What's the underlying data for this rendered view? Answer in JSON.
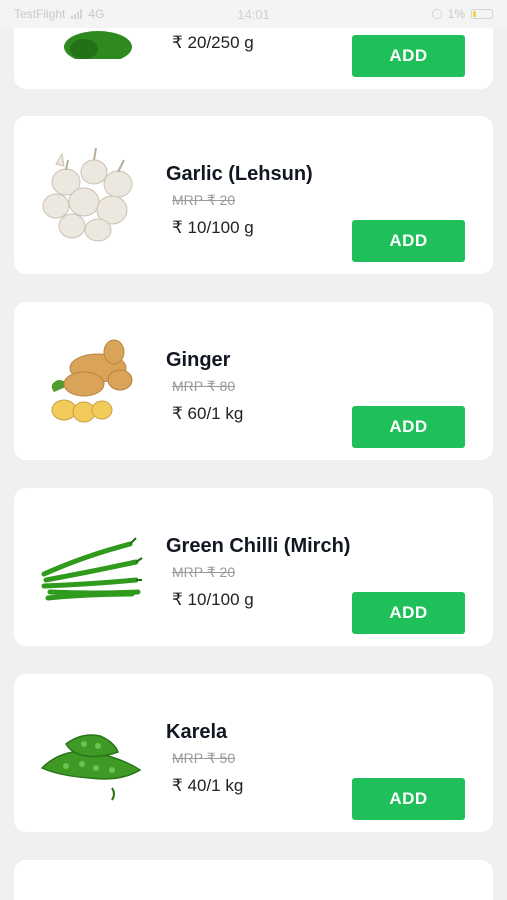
{
  "status_bar": {
    "carrier": "TestFlight",
    "network": "4G",
    "time": "14:01",
    "battery_percent": "1%"
  },
  "products": [
    {
      "name": "",
      "mrp": "",
      "price": "₹ 20/250 g",
      "add_label": "ADD",
      "image_icon": "capsicum-icon"
    },
    {
      "name": "Garlic (Lehsun)",
      "mrp": "MRP ₹ 20",
      "price": "₹ 10/100 g",
      "add_label": "ADD",
      "image_icon": "garlic-icon"
    },
    {
      "name": "Ginger",
      "mrp": "MRP ₹ 80",
      "price": "₹ 60/1 kg",
      "add_label": "ADD",
      "image_icon": "ginger-icon"
    },
    {
      "name": "Green Chilli (Mirch)",
      "mrp": "MRP ₹ 20",
      "price": "₹ 10/100 g",
      "add_label": "ADD",
      "image_icon": "green-chilli-icon"
    },
    {
      "name": "Karela",
      "mrp": "MRP ₹ 50",
      "price": "₹ 40/1 kg",
      "add_label": "ADD",
      "image_icon": "karela-icon"
    }
  ],
  "colors": {
    "add_button": "#1fbf5a",
    "page_bg": "#f0f0f0",
    "card_bg": "#ffffff"
  }
}
